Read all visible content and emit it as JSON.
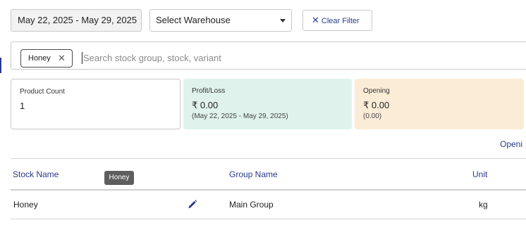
{
  "filters": {
    "date_range": "May 22, 2025 - May 29, 2025",
    "warehouse": "Select Warehouse",
    "clear_filter_label": "Clear Filter"
  },
  "search": {
    "chip_label": "Honey",
    "placeholder": "Search stock group, stock, variant"
  },
  "summary": {
    "product_count": {
      "label": "Product Count",
      "value": "1"
    },
    "profit_loss": {
      "label": "Profit/Loss",
      "value": "₹ 0.00",
      "period": "(May 22, 2025 - May 29, 2025)"
    },
    "opening": {
      "label": "Opening",
      "value": "₹ 0.00",
      "sub": "(0.00)"
    }
  },
  "table": {
    "top_link": "Openi",
    "headers": {
      "stock_name": "Stock Name",
      "group_name": "Group Name",
      "unit": "Unit"
    },
    "tooltip": "Honey",
    "rows": [
      {
        "stock_name": "Honey",
        "group_name": "Main Group",
        "unit": "kg"
      }
    ]
  },
  "colors": {
    "accent": "#2a3a8c",
    "profit_card_bg": "#e0f2ec",
    "opening_card_bg": "#fbecd8"
  }
}
